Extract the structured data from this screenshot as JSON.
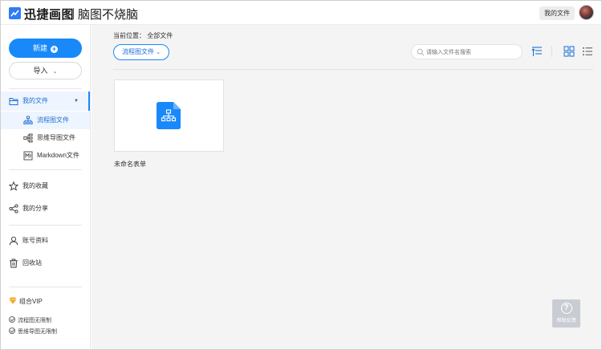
{
  "header": {
    "brand": "迅捷画图",
    "slogan": "脑图不烧脑",
    "my_files_button": "我的文件"
  },
  "sidebar": {
    "new_button": "新建",
    "import_button": "导入",
    "items": [
      {
        "label": "我的文件",
        "icon": "folder-icon",
        "active": true
      },
      {
        "label": "流程图文件",
        "icon": "flowchart-icon",
        "active": true
      },
      {
        "label": "思维导图文件",
        "icon": "mindmap-icon",
        "active": false
      },
      {
        "label": "Markdown文件",
        "icon": "markdown-icon",
        "active": false
      },
      {
        "label": "我的收藏",
        "icon": "star-icon",
        "active": false
      },
      {
        "label": "我的分享",
        "icon": "share-icon",
        "active": false
      },
      {
        "label": "账号资料",
        "icon": "user-icon",
        "active": false
      },
      {
        "label": "回收站",
        "icon": "trash-icon",
        "active": false
      }
    ],
    "vip": {
      "label": "组合VIP",
      "perks": [
        "流程图无限制",
        "思维导图无限制"
      ]
    }
  },
  "main": {
    "breadcrumb": "当前位置：  全部文件",
    "filter_label": "流程图文件",
    "search_placeholder": "请输入文件名搜索",
    "files": [
      {
        "name": "未命名表单",
        "icon": "flowchart-file-icon"
      }
    ],
    "help_label": "帮助反馈"
  },
  "colors": {
    "accent": "#1989fa",
    "active_bg": "#eef5fe",
    "main_bg": "#f4f4f4"
  }
}
